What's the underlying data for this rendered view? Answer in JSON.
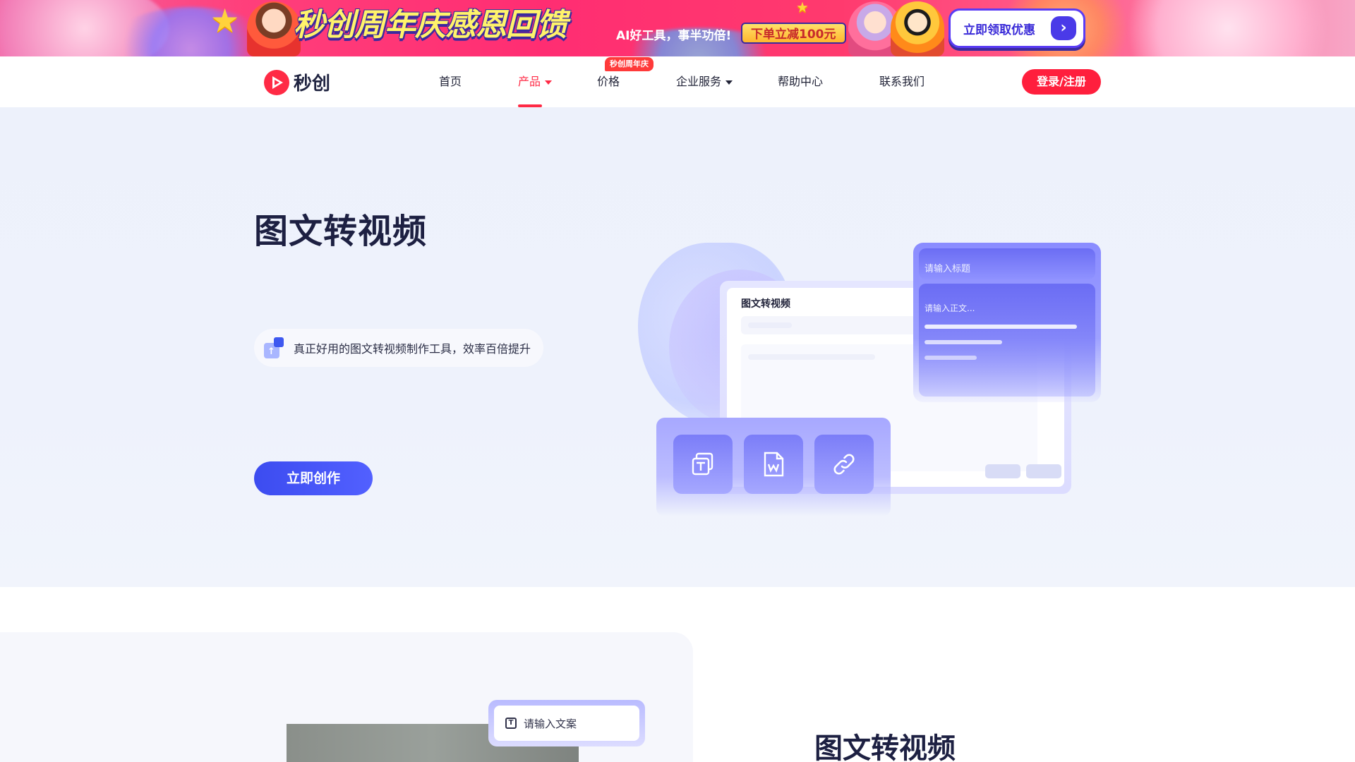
{
  "promo": {
    "title": "秒创周年庆感恩回馈",
    "subtitle": "AI好工具，事半功倍!",
    "badge": "下单立减100元",
    "cta_label": "立即领取优惠",
    "cta_icon": "chevron-right-icon"
  },
  "nav": {
    "brand": "秒创",
    "items": [
      {
        "label": "首页"
      },
      {
        "label": "产品"
      },
      {
        "label": "价格",
        "badge": "秒创周年庆"
      },
      {
        "label": "企业服务"
      },
      {
        "label": "帮助中心"
      },
      {
        "label": "联系我们"
      }
    ],
    "active_index": 1,
    "login_label": "登录/注册",
    "accent": "#ff2a45"
  },
  "hero": {
    "title": "图文转视频",
    "tagline": "真正好用的图文转视频制作工具，效率百倍提升",
    "cta_label": "立即创作",
    "illustration": {
      "window_title": "图文转视频",
      "title_placeholder": "请输入标题",
      "body_placeholder": "请输入正文...",
      "tools": [
        "text-icon",
        "word-doc-icon",
        "link-icon"
      ]
    }
  },
  "section2": {
    "input_placeholder": "请输入文案",
    "title": "图文转视频"
  }
}
